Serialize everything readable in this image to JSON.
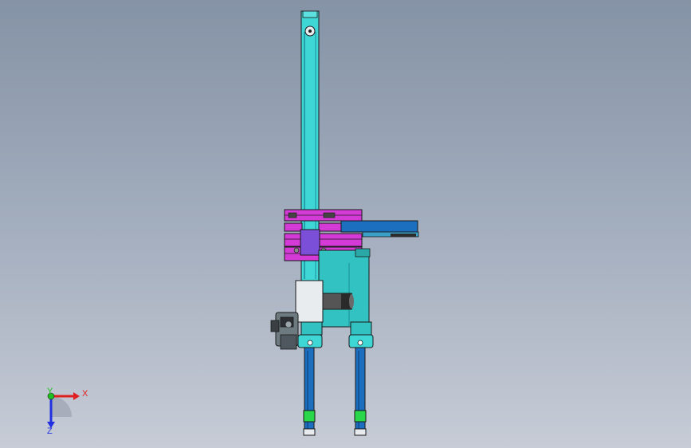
{
  "viewport": {
    "background_top": "#8593a6",
    "background_bottom": "#c7ccd6"
  },
  "model": {
    "colors": {
      "column": "#3fd6d6",
      "column_dark": "#1a8e9a",
      "frame_magenta": "#d43ad6",
      "carriage_purple": "#7c4fd8",
      "arm_blue": "#1c6fbf",
      "body_teal": "#33c2c2",
      "motor_white": "#e8ecef",
      "gripper_green": "#2ad64a",
      "outline": "#1a1a1a"
    }
  },
  "triad": {
    "x_label": "X",
    "y_label": "Y",
    "z_label": "Z",
    "x_color": "#e02020",
    "y_color": "#20c020",
    "z_color": "#2030e0",
    "origin_icon": "coordinate-triad-icon"
  }
}
